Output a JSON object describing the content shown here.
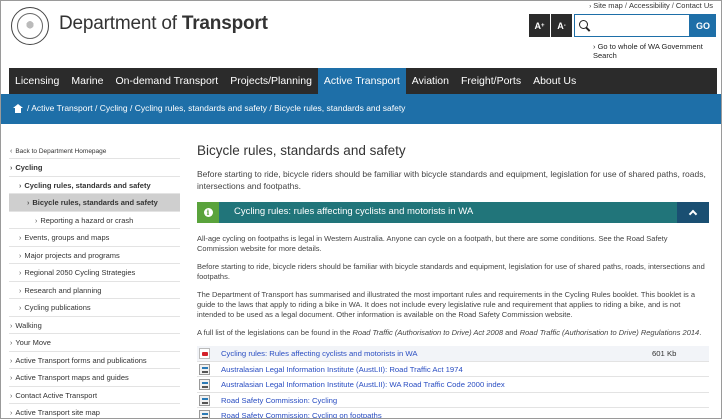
{
  "toplinks": [
    "Site map",
    "Accessibility",
    "Contact Us"
  ],
  "header": {
    "title_regular": "Department of ",
    "title_bold": "Transport",
    "font_up": "A",
    "font_down": "A",
    "search_value": "",
    "go_label": "GO",
    "wagov_link": "Go to whole of WA Government Search"
  },
  "nav": [
    "Licensing",
    "Marine",
    "On-demand Transport",
    "Projects/Planning",
    "Active Transport",
    "Aviation",
    "Freight/Ports",
    "About Us"
  ],
  "nav_active": "Active Transport",
  "breadcrumb": "/ Active Transport / Cycling / Cycling rules, standards and safety / Bicycle rules, standards and safety",
  "sidebar": {
    "back": "Back to Department Homepage",
    "items": [
      {
        "label": "Cycling",
        "level": 0,
        "bold": true
      },
      {
        "label": "Cycling rules, standards and safety",
        "level": 1,
        "bold": true
      },
      {
        "label": "Bicycle rules, standards and safety",
        "level": 2,
        "current": true
      },
      {
        "label": "Reporting a hazard or crash",
        "level": 3
      },
      {
        "label": "Events, groups and maps",
        "level": 1
      },
      {
        "label": "Major projects and programs",
        "level": 1
      },
      {
        "label": "Regional 2050 Cycling Strategies",
        "level": 1
      },
      {
        "label": "Research and planning",
        "level": 1
      },
      {
        "label": "Cycling publications",
        "level": 1
      },
      {
        "label": "Walking",
        "level": 0
      },
      {
        "label": "Your Move",
        "level": 0
      },
      {
        "label": "Active Transport forms and publications",
        "level": 0
      },
      {
        "label": "Active Transport maps and guides",
        "level": 0
      },
      {
        "label": "Contact Active Transport",
        "level": 0
      },
      {
        "label": "Active Transport site map",
        "level": 0
      }
    ]
  },
  "main": {
    "title": "Bicycle rules, standards and safety",
    "intro": "Before starting to ride, bicycle riders should be familiar with bicycle standards and equipment, legislation for use of shared paths, roads, intersections and footpaths.",
    "accordion_title": "Cycling rules: rules affecting cyclists and motorists in WA",
    "p1": "All-age cycling on footpaths is legal in Western Australia. Anyone can cycle on a footpath, but there are some conditions. See the Road Safety Commission website for more details.",
    "p2": "Before starting to ride, bicycle riders should be familiar with bicycle standards and equipment, legislation for use of shared paths, roads, intersections and footpaths.",
    "p3": "The Department of Transport has summarised and illustrated the most important rules and requirements in the Cycling Rules booklet. This booklet is a guide to the laws that apply to riding a bike in WA. It does not include every legislative rule and requirement that applies to riding a bike, and is not intended to be used as a legal document. Other information is available on the Road Safety Commission website.",
    "p4_prefix": "A full list of the legislations can be found in the ",
    "p4_act1": "Road Traffic (Authorisation to Drive) Act 2008",
    "p4_and": " and ",
    "p4_act2": "Road Traffic (Authorisation to Drive) Regulations 2014",
    "p4_suffix": ".",
    "files": [
      {
        "type": "pdf",
        "label": "Cycling rules: Rules affecting cyclists and motorists in WA",
        "size": "601 Kb"
      },
      {
        "type": "html",
        "label": "Australasian Legal Information Institute (AustLII): Road Traffic Act 1974",
        "size": ""
      },
      {
        "type": "html",
        "label": "Australasian Legal Information Institute (AustLII): WA Road Traffic Code 2000 index",
        "size": ""
      },
      {
        "type": "html",
        "label": "Road Safety Commission: Cycling",
        "size": ""
      },
      {
        "type": "html",
        "label": "Road Safety Commission: Cycling on footpaths",
        "size": ""
      }
    ]
  }
}
